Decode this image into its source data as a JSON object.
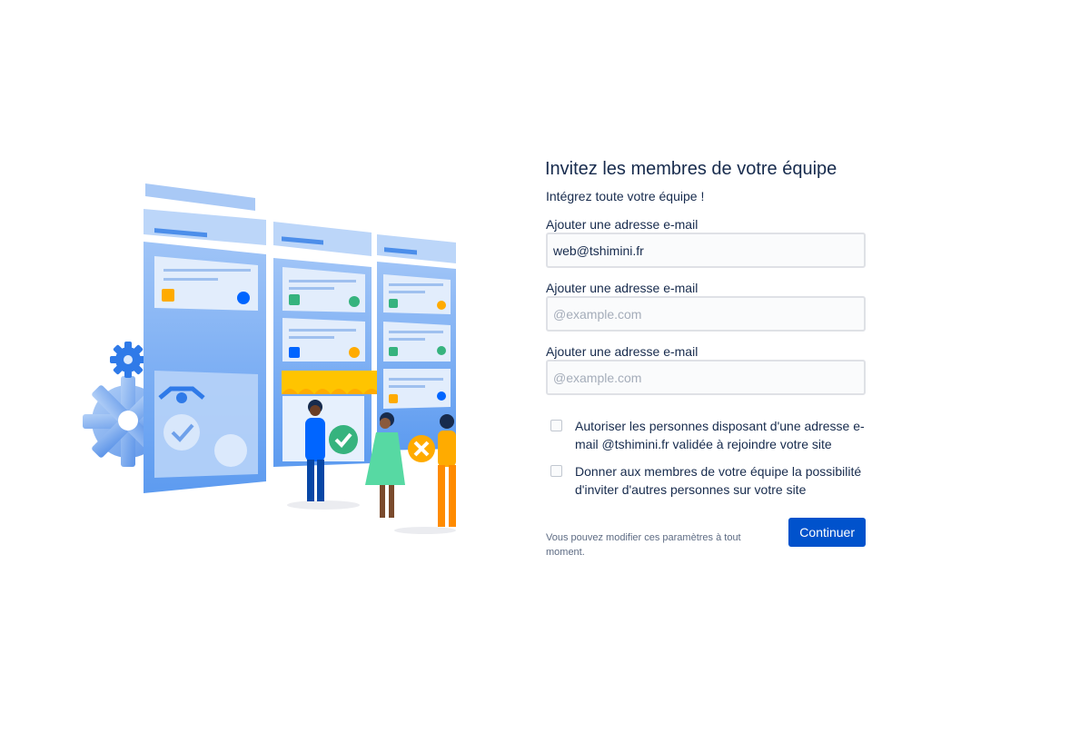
{
  "invite": {
    "title": "Invitez les membres de votre équipe",
    "subtitle": "Intégrez toute votre équipe !",
    "fields": [
      {
        "label": "Ajouter une adresse e-mail",
        "value": "web@tshimini.fr",
        "placeholder": "@example.com"
      },
      {
        "label": "Ajouter une adresse e-mail",
        "value": "",
        "placeholder": "@example.com"
      },
      {
        "label": "Ajouter une adresse e-mail",
        "value": "",
        "placeholder": "@example.com"
      }
    ],
    "options": [
      {
        "label": "Autoriser les personnes disposant d'une adresse e-mail @tshimini.fr validée à rejoindre votre site",
        "checked": false
      },
      {
        "label": "Donner aux membres de votre équipe la possibilité d'inviter d'autres personnes sur votre site",
        "checked": false
      }
    ],
    "footer_note": "Vous pouvez modifier ces paramètres à tout moment.",
    "continue_label": "Continuer"
  },
  "colors": {
    "primary": "#0052cc",
    "text": "#172b4d",
    "input_border": "#dfe1e6",
    "input_bg": "#fafbfc"
  }
}
